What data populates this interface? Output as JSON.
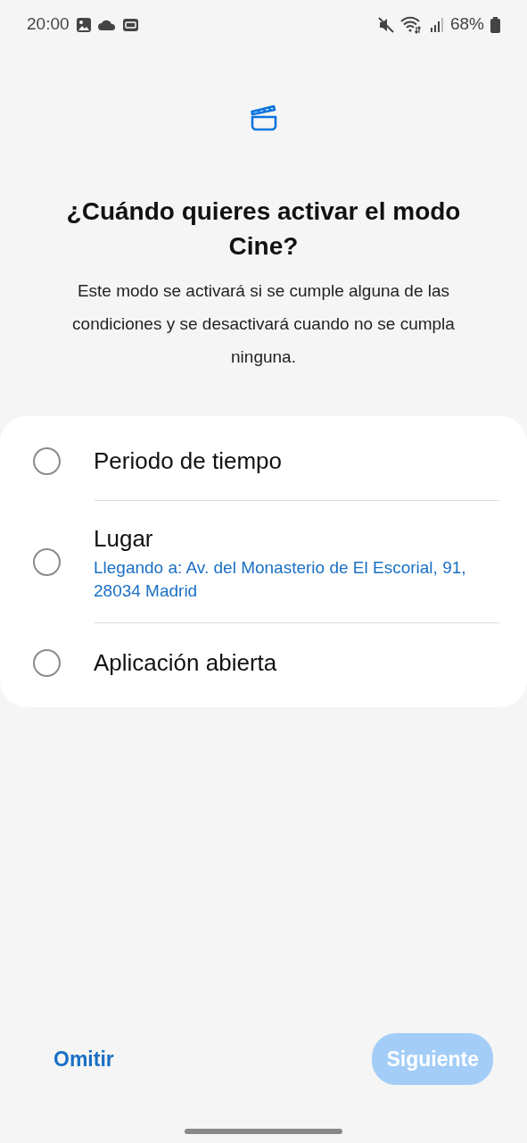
{
  "status_bar": {
    "time": "20:00",
    "battery": "68%"
  },
  "title": "¿Cuándo quieres activar el modo Cine?",
  "description": "Este modo se activará si se cumple alguna de las condiciones y se desactivará cuando no se cumpla ninguna.",
  "options": [
    {
      "label": "Periodo de tiempo",
      "selected": false
    },
    {
      "label": "Lugar",
      "detail": "Llegando a: Av. del Monasterio de El Escorial, 91, 28034 Madrid",
      "selected": false
    },
    {
      "label": "Aplicación abierta",
      "selected": false
    }
  ],
  "skip_button": "Omitir",
  "next_button": {
    "label": "Siguiente",
    "disabled": true
  }
}
